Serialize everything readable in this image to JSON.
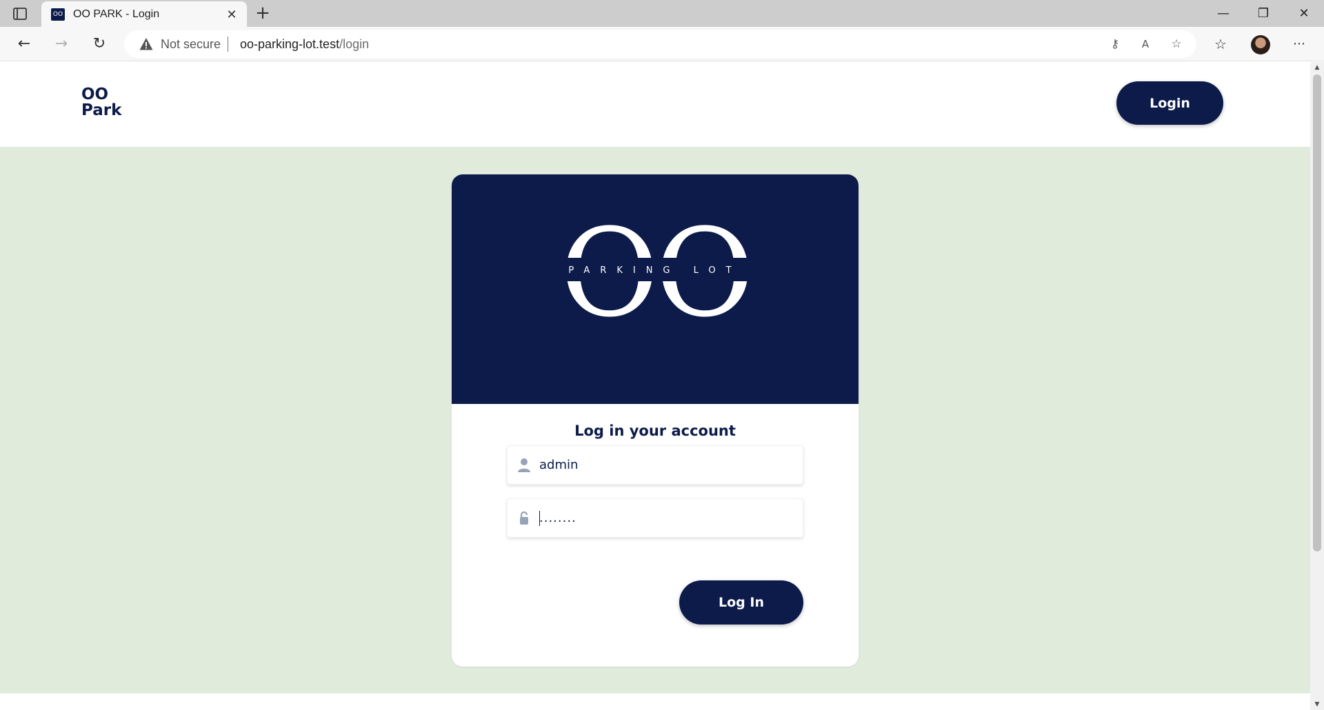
{
  "browser": {
    "tab_title": "OO PARK - Login",
    "favicon_text": "OO",
    "new_tab": "+",
    "address": {
      "security_label": "Not secure",
      "url_host": "oo-parking-lot.test",
      "url_path": "/login"
    },
    "window_controls": {
      "minimize": "—",
      "restore": "❐",
      "close": "✕"
    }
  },
  "site": {
    "brand_line1": "OO",
    "brand_line2": "Park",
    "header_login": "Login"
  },
  "login_card": {
    "logo_letters": "OO",
    "logo_tagline": "PARKING LOT",
    "title": "Log in your account",
    "username": {
      "value": "admin",
      "placeholder": ""
    },
    "password": {
      "value": "........",
      "placeholder": ""
    },
    "submit_label": "Log In"
  },
  "colors": {
    "brand_navy": "#0d1b4a",
    "page_green": "#e1ebdc"
  }
}
